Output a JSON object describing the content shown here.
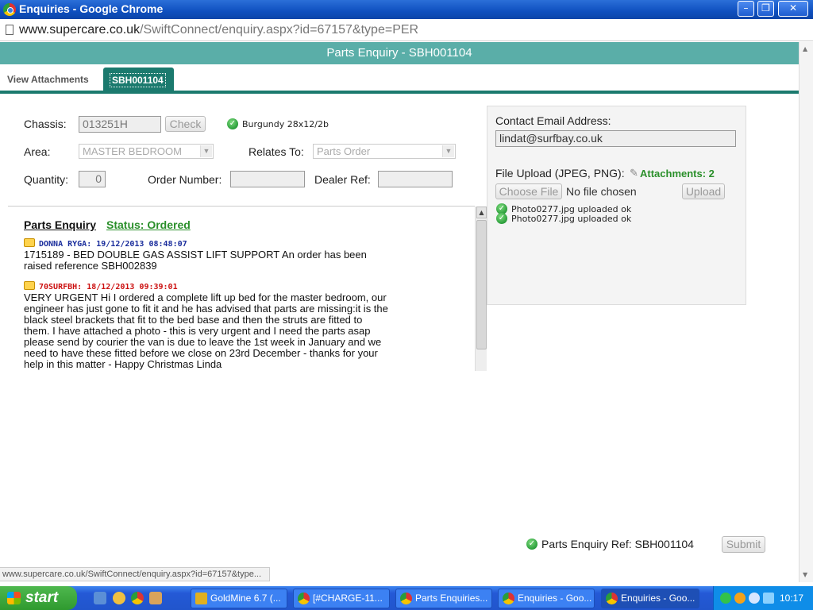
{
  "window": {
    "title": "Enquiries - Google Chrome",
    "minimize": "–",
    "maximize": "❐",
    "close": "✕"
  },
  "address": {
    "domain": "www.supercare.co.uk",
    "path": "/SwiftConnect/enquiry.aspx?id=67157&type=PER"
  },
  "header": {
    "title": "Parts Enquiry - SBH001104"
  },
  "tabs": [
    {
      "label": "View Attachments"
    },
    {
      "label": "SBH001104"
    }
  ],
  "form": {
    "chassis_label": "Chassis:",
    "chassis_value": "013251H",
    "check_button": "Check",
    "chassis_result": "Burgundy 28x12/2b",
    "area_label": "Area:",
    "area_value": "MASTER BEDROOM",
    "relates_label": "Relates To:",
    "relates_value": "Parts Order",
    "quantity_label": "Quantity:",
    "quantity_value": "0",
    "order_number_label": "Order Number:",
    "order_number_value": "",
    "dealer_ref_label": "Dealer Ref:",
    "dealer_ref_value": ""
  },
  "log": {
    "title": "Parts Enquiry",
    "status": "Status: Ordered",
    "messages": [
      {
        "author": "DONNA RYGA: 19/12/2013 08:48:07",
        "author_color": "#1a2d9c",
        "text": "1715189 - BED DOUBLE GAS ASSIST LIFT SUPPORT An order has been raised reference SBH002839"
      },
      {
        "author": "70SURFBH: 18/12/2013 09:39:01",
        "author_color": "#cc1111",
        "text": "VERY URGENT Hi I ordered a complete lift up bed for the master bedroom, our engineer has just gone to fit it and he has advised that parts are missing:it is the black steel brackets that fit to the bed base and then the struts are fitted to them. I have attached a photo - this is very urgent and I need the parts asap please send by courier the van is due to leave the 1st week in January and we need to have these fitted before we close on 23rd December - thanks for your help in this matter - Happy Christmas Linda"
      }
    ]
  },
  "contact": {
    "email_label": "Contact Email Address:",
    "email_value": "lindat@surfbay.co.uk",
    "upload_label": "File Upload (JPEG, PNG):",
    "attachments": "Attachments: 2",
    "choose_button": "Choose File",
    "no_file": "No file chosen",
    "upload_button": "Upload",
    "uploaded": [
      "Photo0277.jpg uploaded ok",
      "Photo0277.jpg uploaded ok"
    ]
  },
  "footer": {
    "ref": "Parts Enquiry Ref: SBH001104",
    "submit": "Submit",
    "status_url": "www.supercare.co.uk/SwiftConnect/enquiry.aspx?id=67157&type..."
  },
  "taskbar": {
    "start": "start",
    "tasks": [
      {
        "label": "GoldMine 6.7 (..."
      },
      {
        "label": "[#CHARGE-11..."
      },
      {
        "label": "Parts Enquiries..."
      },
      {
        "label": "Enquiries - Goo..."
      },
      {
        "label": "Enquiries - Goo..."
      }
    ],
    "clock": "10:17"
  }
}
